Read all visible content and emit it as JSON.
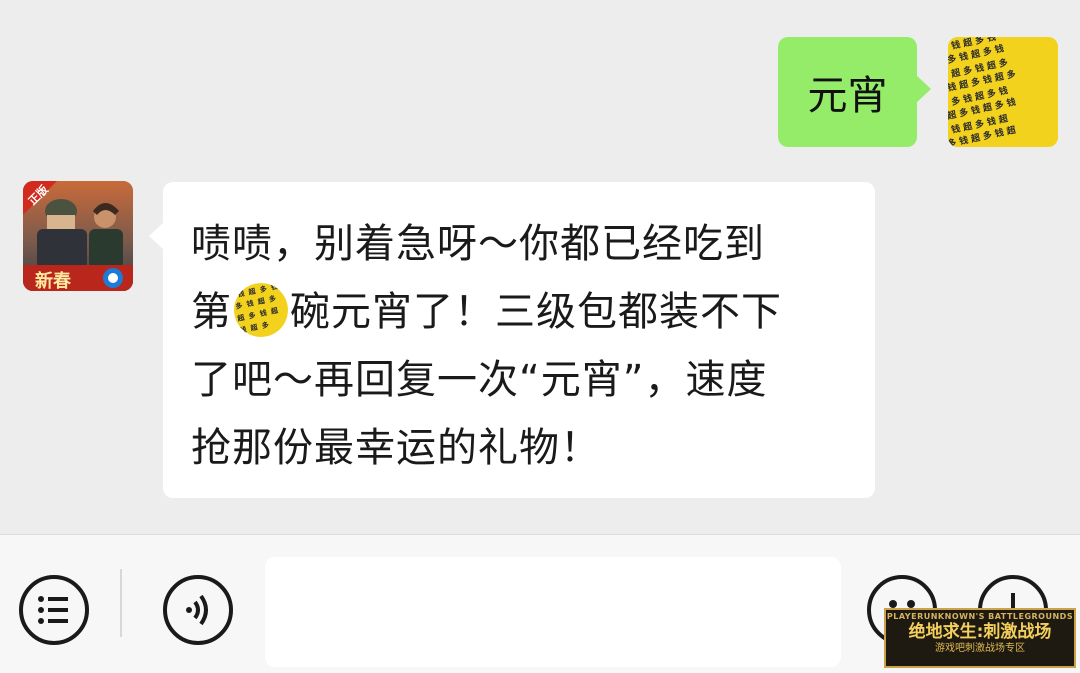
{
  "chat": {
    "sent_message": {
      "text": "元宵"
    },
    "received_message": {
      "line1": "啧啧，别着急呀～你都已经吃到",
      "line2_before": "第",
      "line2_after": "碗元宵了！三级包都装不下",
      "line3": "了吧～再回复一次“元宵”，速度",
      "line4": "抢那份最幸运的礼物！"
    }
  },
  "avatars": {
    "self_pattern_text": "超多钱",
    "other_badge": "正版",
    "other_label": "新春"
  },
  "toolbar": {
    "input_placeholder": ""
  },
  "watermark": {
    "top_text": "PLAYERUNKNOWN'S BATTLEGROUNDS",
    "main_text": "绝地求生:刺激战场",
    "sub_text": "游戏吧刺激战场专区"
  },
  "colors": {
    "background": "#ededed",
    "sent_bubble": "#95ec69",
    "received_bubble": "#ffffff",
    "self_avatar": "#f3d21d"
  }
}
